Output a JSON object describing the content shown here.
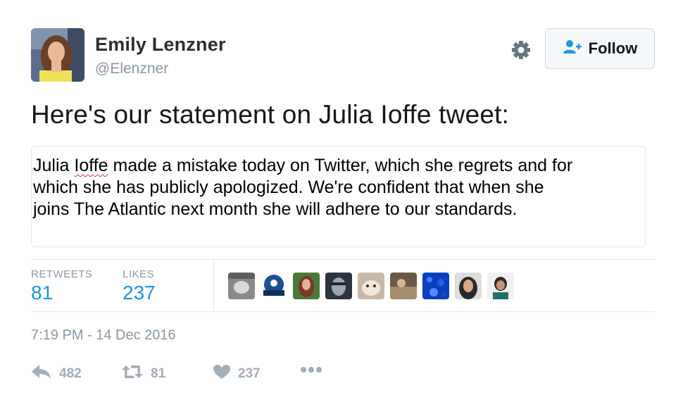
{
  "author": {
    "name": "Emily Lenzner",
    "handle": "@Elenzner"
  },
  "header": {
    "follow_label": "Follow",
    "settings_icon": "gear-icon",
    "follow_icon": "add-user-icon"
  },
  "tweet": {
    "text": "Here's our statement on Julia Ioffe tweet:",
    "statement": {
      "line1_pre": "Julia ",
      "line1_flagged": "Ioffe",
      "line1_post": " made a mistake today on Twitter, which she regrets and for",
      "line2": "which she has publicly apologized.  We're confident that when she",
      "line3": "joins The Atlantic next month she will adhere to our standards."
    }
  },
  "stats": {
    "retweets_label": "RETWEETS",
    "retweets_value": "81",
    "likes_label": "LIKES",
    "likes_value": "237"
  },
  "timestamp": "7:19 PM - 14 Dec 2016",
  "actions": {
    "reply_count": "482",
    "retweet_count": "81",
    "like_count": "237",
    "reply_icon": "reply-icon",
    "retweet_icon": "retweet-icon",
    "like_icon": "heart-icon",
    "more_icon": "more-icon"
  },
  "colors": {
    "link_blue": "#1b95e0",
    "muted_gray": "#8899a6",
    "action_gray": "#a2aeb8"
  }
}
